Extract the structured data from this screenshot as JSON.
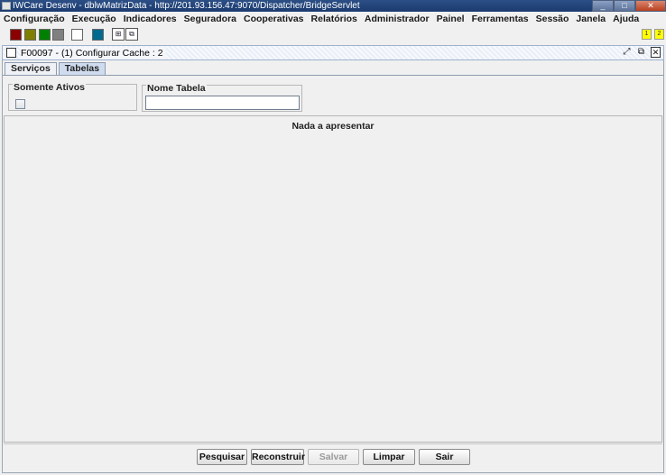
{
  "window": {
    "title": "IWCare Desenv - dblwMatrizData - http://201.93.156.47:9070/Dispatcher/BridgeServlet",
    "controls": {
      "minimize": "_",
      "maximize": "□",
      "close": "✕"
    }
  },
  "menu": [
    "Configuração",
    "Execução",
    "Indicadores",
    "Seguradora",
    "Cooperativas",
    "Relatórios",
    "Administrador",
    "Painel",
    "Ferramentas",
    "Sessão",
    "Janela",
    "Ajuda"
  ],
  "toolbar": {
    "swatches": [
      "#8b0000",
      "#808000",
      "#008000",
      "#808080",
      "#ffffff",
      "#006b8f"
    ],
    "badges": [
      "1",
      "2"
    ]
  },
  "internal_frame": {
    "title": "F00097 - (1) Configurar Cache : 2",
    "controls": {
      "restore": "⤢",
      "popout": "⧉",
      "close": "✕"
    }
  },
  "tabs": [
    {
      "label": "Serviços",
      "active": false
    },
    {
      "label": "Tabelas",
      "active": true
    }
  ],
  "filters": {
    "somente_ativos": {
      "label": "Somente Ativos",
      "checked": false
    },
    "nome_tabela": {
      "label": "Nome Tabela",
      "value": "",
      "placeholder": ""
    }
  },
  "results": {
    "empty_message": "Nada a apresentar"
  },
  "buttons": {
    "pesquisar": "Pesquisar",
    "reconstruir": "Reconstruir",
    "salvar": "Salvar",
    "limpar": "Limpar",
    "sair": "Sair"
  }
}
